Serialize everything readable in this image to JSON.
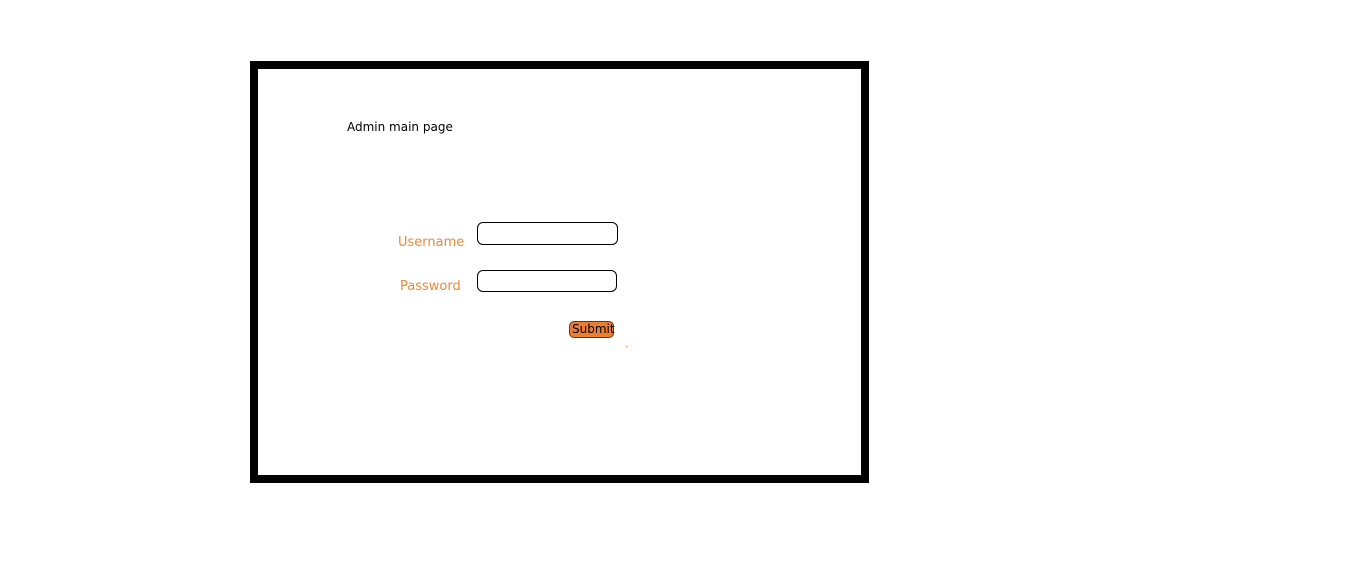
{
  "page": {
    "title": "Admin main page"
  },
  "login_form": {
    "username_label": "Username",
    "username_value": "",
    "password_label": "Password",
    "password_value": "",
    "submit_label": "Submit"
  },
  "colors": {
    "frame_border": "#000000",
    "label_text": "#e98a3a",
    "submit_fill": "#ed7d31"
  }
}
